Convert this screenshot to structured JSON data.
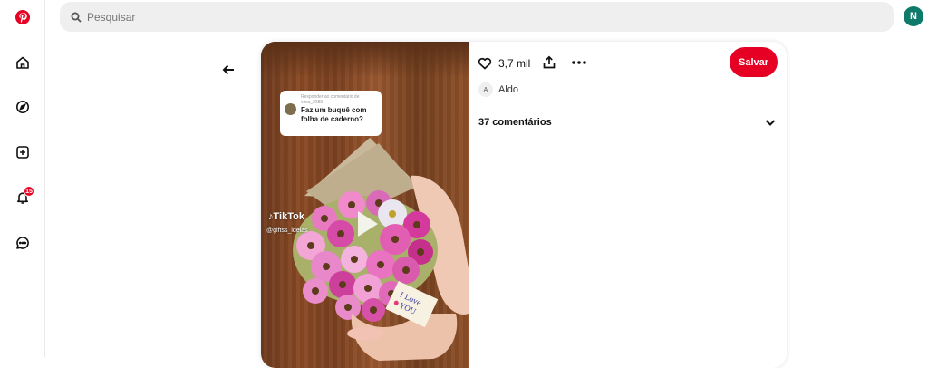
{
  "nav": {
    "icons": [
      "pinterest-logo",
      "home-icon",
      "compass-icon",
      "create-icon",
      "bell-icon",
      "chat-icon"
    ],
    "notification_count": "15"
  },
  "search": {
    "placeholder": "Pesquisar"
  },
  "user": {
    "initial": "N"
  },
  "pin": {
    "overlay": {
      "reply_label": "Responder ao comentário de elisa_2389",
      "question": "Faz um buquê com folha de caderno?",
      "watermark": "TikTok",
      "handle": "@giftss_ideias"
    },
    "likes": "3,7 mil",
    "save_label": "Salvar",
    "author_initial": "A",
    "author_name": "Aldo",
    "comments_label": "37 comentários"
  },
  "colors": {
    "brand_red": "#e60023",
    "avatar_green": "#0f7a6a"
  }
}
